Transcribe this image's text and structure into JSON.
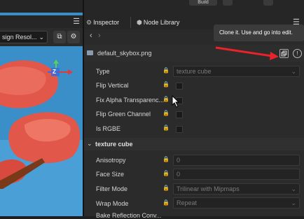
{
  "scene": {
    "resolution_label": "sign Resol...",
    "colors": {
      "sky": "#3a8fc9",
      "tree": "#e1584a",
      "trunk": "#7a3a1a"
    },
    "gizmo": {
      "z_label": "Z"
    }
  },
  "top_toolbar": {
    "build_label": "Build"
  },
  "tabs": [
    {
      "label": "Inspector",
      "icon": "gear-icon"
    },
    {
      "label": "Node Library",
      "icon": "node-library-icon"
    }
  ],
  "tooltip": {
    "text": "Clone it. Use and go into edit."
  },
  "asset": {
    "filename": "default_skybox.png"
  },
  "properties": [
    {
      "label": "Type",
      "kind": "select",
      "value": "texture cube"
    },
    {
      "label": "Flip Vertical",
      "kind": "checkbox"
    },
    {
      "label": "Fix Alpha Transparenc...",
      "kind": "checkbox"
    },
    {
      "label": "Flip Green Channel",
      "kind": "checkbox"
    },
    {
      "label": "Is RGBE",
      "kind": "checkbox"
    }
  ],
  "section": {
    "title": "texture cube"
  },
  "cube_properties": [
    {
      "label": "Anisotropy",
      "kind": "number",
      "value": "0"
    },
    {
      "label": "Face Size",
      "kind": "number",
      "value": "0"
    },
    {
      "label": "Filter Mode",
      "kind": "select",
      "value": "Trilinear with Mipmaps"
    },
    {
      "label": "Wrap Mode",
      "kind": "select",
      "value": "Repeat"
    },
    {
      "label": "Bake Reflection Conv...",
      "kind": "checkbox"
    }
  ],
  "annotation": {
    "arrow_color": "#e8232a"
  }
}
